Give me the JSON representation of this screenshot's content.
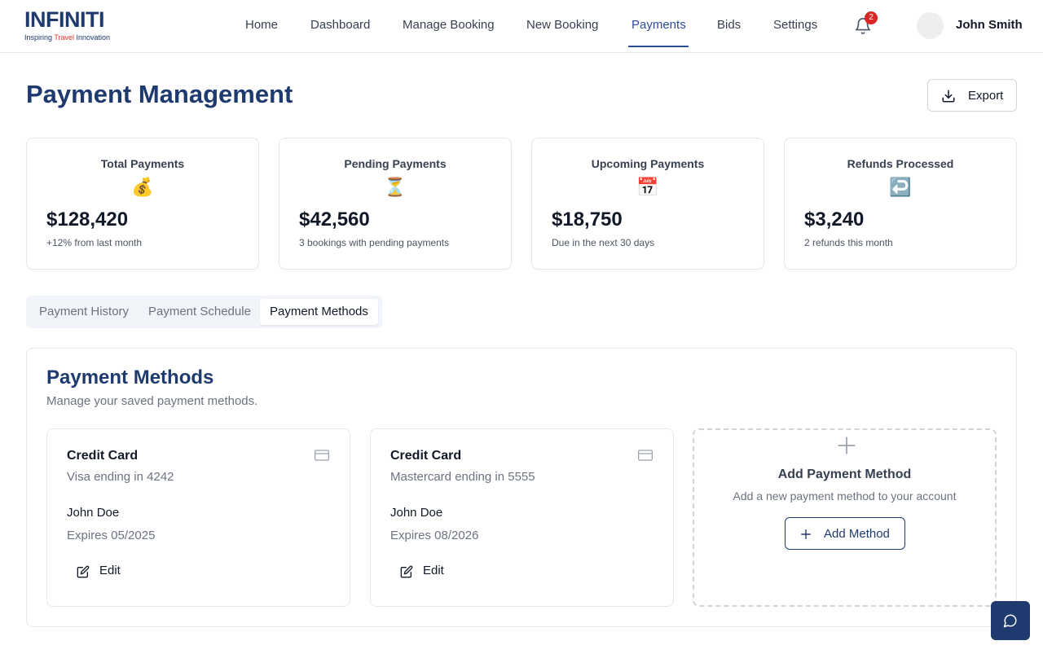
{
  "brand": {
    "name": "INFINITI",
    "tagline_prefix": "Inspiring ",
    "tagline_accent": "Travel",
    "tagline_suffix": " Innovation"
  },
  "nav": {
    "items": [
      {
        "label": "Home"
      },
      {
        "label": "Dashboard"
      },
      {
        "label": "Manage Booking"
      },
      {
        "label": "New Booking"
      },
      {
        "label": "Payments"
      },
      {
        "label": "Bids"
      },
      {
        "label": "Settings"
      }
    ],
    "active": "Payments",
    "notification_count": "2",
    "user_name": "John Smith"
  },
  "page": {
    "title": "Payment Management",
    "export_label": "Export"
  },
  "stats": [
    {
      "title": "Total Payments",
      "icon": "💰",
      "icon_name": "money-bag-icon",
      "value": "$128,420",
      "sub": "+12% from last month"
    },
    {
      "title": "Pending Payments",
      "icon": "⏳",
      "icon_name": "hourglass-icon",
      "value": "$42,560",
      "sub": "3 bookings with pending payments"
    },
    {
      "title": "Upcoming Payments",
      "icon": "📅",
      "icon_name": "calendar-icon",
      "value": "$18,750",
      "sub": "Due in the next 30 days"
    },
    {
      "title": "Refunds Processed",
      "icon": "↩️",
      "icon_name": "return-arrow-icon",
      "value": "$3,240",
      "sub": "2 refunds this month"
    }
  ],
  "tabs": [
    {
      "label": "Payment History"
    },
    {
      "label": "Payment Schedule"
    },
    {
      "label": "Payment Methods"
    }
  ],
  "active_tab": "Payment Methods",
  "methods": {
    "title": "Payment Methods",
    "subtitle": "Manage your saved payment methods.",
    "cards": [
      {
        "type": "Credit Card",
        "desc": "Visa ending in 4242",
        "holder": "John Doe",
        "expiry": "Expires 05/2025",
        "edit_label": "Edit"
      },
      {
        "type": "Credit Card",
        "desc": "Mastercard ending in 5555",
        "holder": "John Doe",
        "expiry": "Expires 08/2026",
        "edit_label": "Edit"
      }
    ],
    "add": {
      "title": "Add Payment Method",
      "subtitle": "Add a new payment method to your account",
      "button_label": "Add Method"
    }
  },
  "colors": {
    "brand_navy": "#1e3a6e",
    "nav_active": "#2c4b9a",
    "badge_red": "#dc2626",
    "tagline_red": "#e0322b"
  }
}
